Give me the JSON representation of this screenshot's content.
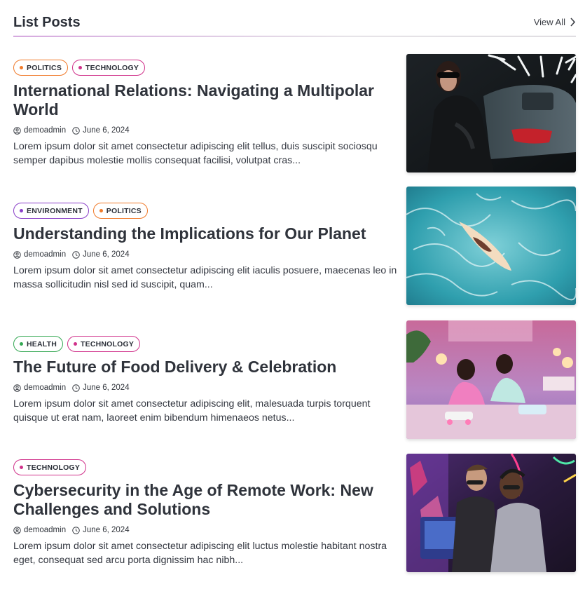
{
  "header": {
    "title": "List Posts",
    "view_all": "View All"
  },
  "tag_colors": {
    "POLITICS": "#f07a2a",
    "TECHNOLOGY": "#d0318a",
    "ENVIRONMENT": "#8a3fc8",
    "HEALTH": "#34a853"
  },
  "posts": [
    {
      "tags": [
        "POLITICS",
        "TECHNOLOGY"
      ],
      "title": "International Relations: Navigating a Multipolar World",
      "author": "demoadmin",
      "date": "June 6, 2024",
      "excerpt": "Lorem ipsum dolor sit amet consectetur adipiscing elit tellus, duis suscipit sociosqu semper dapibus molestie mollis consequat facilisi, volutpat cras...",
      "image": "woman-with-car-neon-photo"
    },
    {
      "tags": [
        "ENVIRONMENT",
        "POLITICS"
      ],
      "title": "Understanding the Implications for Our Planet",
      "author": "demoadmin",
      "date": "June 6, 2024",
      "excerpt": "Lorem ipsum dolor sit amet consectetur adipiscing elit iaculis posuere, maecenas leo in massa sollicitudin nisl sed id suscipit, quam...",
      "image": "surfer-ocean-aerial-photo"
    },
    {
      "tags": [
        "HEALTH",
        "TECHNOLOGY"
      ],
      "title": "The Future of Food Delivery & Celebration",
      "author": "demoadmin",
      "date": "June 6, 2024",
      "excerpt": "Lorem ipsum dolor sit amet consectetur adipiscing elit, malesuada turpis torquent quisque ut erat nam, laoreet enim bibendum himenaeos netus...",
      "image": "friends-party-room-photo"
    },
    {
      "tags": [
        "TECHNOLOGY"
      ],
      "title": "Cybersecurity in the Age of Remote Work: New Challenges and Solutions",
      "author": "demoadmin",
      "date": "June 6, 2024",
      "excerpt": "Lorem ipsum dolor sit amet consectetur adipiscing elit luctus molestie habitant nostra eget, consequat sed arcu porta dignissim hac nibh...",
      "image": "gamers-neon-arcade-photo"
    }
  ]
}
